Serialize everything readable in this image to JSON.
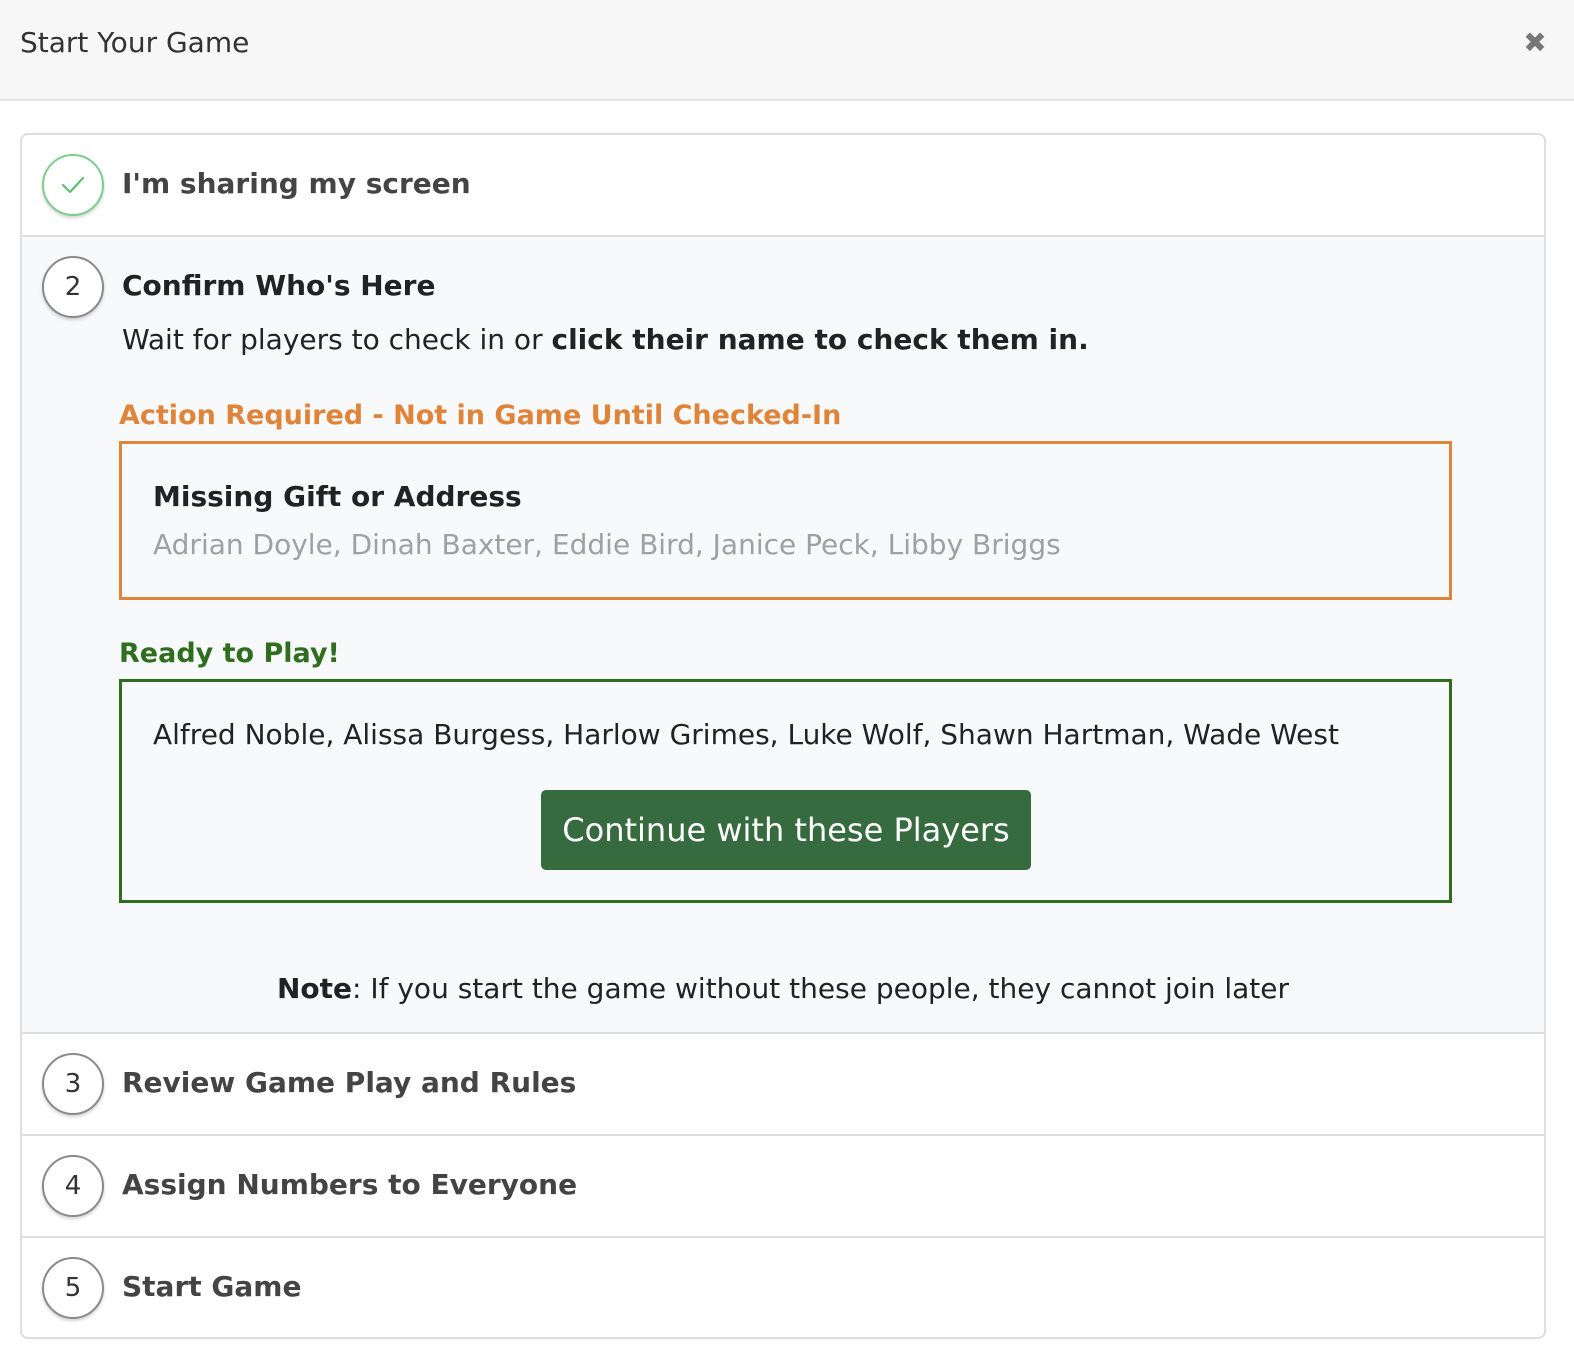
{
  "header": {
    "title": "Start Your Game",
    "close_symbol": "✖"
  },
  "steps": [
    {
      "number": "",
      "title": "I'm sharing my screen",
      "status": "done"
    },
    {
      "number": "2",
      "title": "Confirm Who's Here",
      "status": "active",
      "instruction_prefix": "Wait for players to check in or ",
      "instruction_bold": "click their name to check them in."
    },
    {
      "number": "3",
      "title": "Review Game Play and Rules",
      "status": "pending"
    },
    {
      "number": "4",
      "title": "Assign Numbers to Everyone",
      "status": "pending"
    },
    {
      "number": "5",
      "title": "Start Game",
      "status": "pending"
    }
  ],
  "action_required": {
    "label": "Action Required - Not in Game Until Checked-In",
    "box_title": "Missing Gift or Address",
    "names": "Adrian Doyle, Dinah Baxter, Eddie Bird, Janice Peck, Libby Briggs"
  },
  "ready": {
    "label": "Ready to Play!",
    "names": "Alfred Noble, Alissa Burgess, Harlow Grimes, Luke Wolf, Shawn Hartman, Wade West",
    "button_label": "Continue with these Players"
  },
  "note": {
    "bold": "Note",
    "text": ": If you start the game without these people, they cannot join later"
  },
  "colors": {
    "orange": "#e0843a",
    "green": "#2f6d1f",
    "button": "#356b3f",
    "check": "#5cc071"
  }
}
